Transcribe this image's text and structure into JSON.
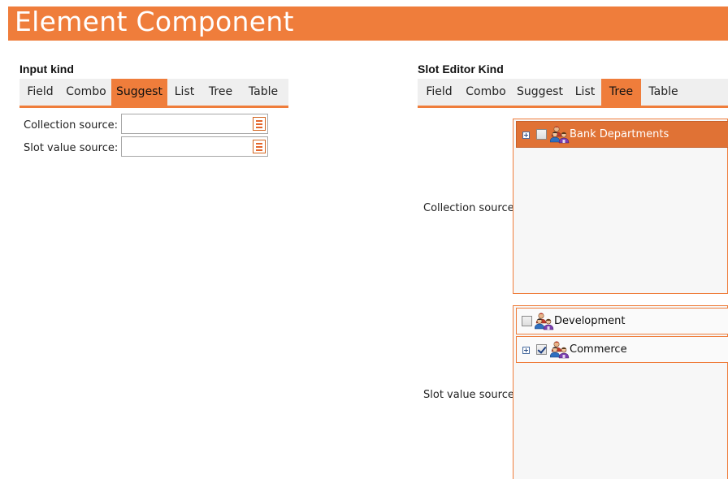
{
  "header": {
    "title": "Element Component"
  },
  "input_kind": {
    "title": "Input kind",
    "tabs": [
      {
        "label": "Field",
        "active": false
      },
      {
        "label": "Combo",
        "active": false
      },
      {
        "label": "Suggest",
        "active": true
      },
      {
        "label": "List",
        "active": false
      },
      {
        "label": "Tree",
        "active": false
      },
      {
        "label": "Table",
        "active": false
      }
    ],
    "fields": [
      {
        "label": "Collection source:",
        "value": "",
        "button_icon": "list-icon"
      },
      {
        "label": "Slot value source:",
        "value": "",
        "button_icon": "list-icon"
      }
    ]
  },
  "slot_editor_kind": {
    "title": "Slot Editor Kind",
    "tabs": [
      {
        "label": "Field",
        "active": false
      },
      {
        "label": "Combo",
        "active": false
      },
      {
        "label": "Suggest",
        "active": false
      },
      {
        "label": "List",
        "active": false
      },
      {
        "label": "Tree",
        "active": true
      },
      {
        "label": "Table",
        "active": false
      }
    ],
    "collection_source": {
      "label": "Collection source:",
      "nodes": [
        {
          "label": "Bank Departments",
          "expandable": true,
          "checked": false,
          "selected": true,
          "icon": "user-group-icon"
        }
      ]
    },
    "slot_value_source": {
      "label": "Slot value source:",
      "nodes": [
        {
          "label": "Development",
          "expandable": false,
          "checked": false,
          "selected": false,
          "icon": "user-group-icon"
        },
        {
          "label": "Commerce",
          "expandable": true,
          "checked": true,
          "selected": false,
          "icon": "user-group-icon"
        }
      ]
    }
  },
  "colors": {
    "accent": "#ef7d3b",
    "tab_bar": "#efefef",
    "tree_bg": "#f7f7f7"
  }
}
